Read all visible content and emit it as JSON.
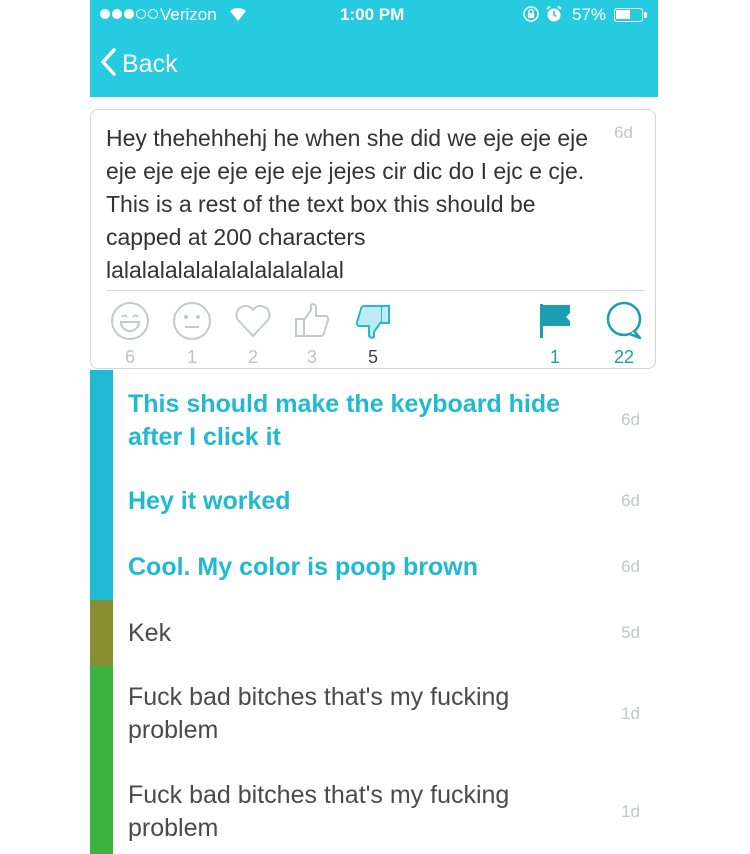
{
  "status": {
    "carrier": "Verizon",
    "time": "1:00 PM",
    "battery_pct": "57%",
    "battery_level": 0.57
  },
  "nav": {
    "back_label": "Back"
  },
  "post": {
    "text": "Hey thehehhehj he when she did we eje eje eje eje eje eje eje eje eje jejes cir dic do I ejc e cje. This is a rest of the text box this should be capped at 200 characters lalalalalalalalalalalalalal",
    "age": "6d",
    "reactions": [
      {
        "icon": "laughing-face-icon",
        "count": "6"
      },
      {
        "icon": "neutral-face-icon",
        "count": "1"
      },
      {
        "icon": "heart-icon",
        "count": "2"
      },
      {
        "icon": "thumbs-up-icon",
        "count": "3"
      },
      {
        "icon": "thumbs-down-icon",
        "count": "5"
      }
    ],
    "flag": {
      "icon": "flag-icon",
      "count": "1"
    },
    "comment_count": {
      "icon": "comment-bubble-icon",
      "count": "22"
    }
  },
  "colors": {
    "accent": "#27cbe0",
    "comment_teal": "#1fbad1",
    "bar_brown": "#8a8f30",
    "bar_green": "#3db23f"
  },
  "comments": [
    {
      "text": "This should make the keyboard hide after I click it",
      "age": "6d"
    },
    {
      "text": "Hey it worked",
      "age": "6d"
    },
    {
      "text": "Cool. My color is poop brown",
      "age": "6d"
    },
    {
      "text": "Kek",
      "age": "5d"
    },
    {
      "text": "Fuck bad bitches that's my fucking problem",
      "age": "1d"
    },
    {
      "text": "Fuck bad bitches that's my fucking problem",
      "age": "1d"
    }
  ]
}
